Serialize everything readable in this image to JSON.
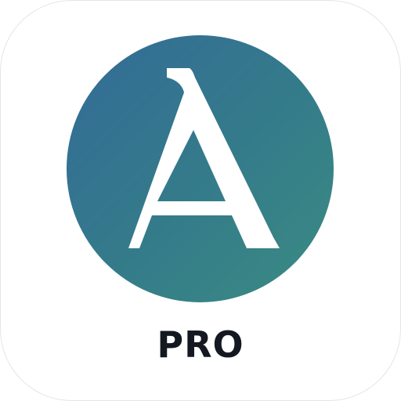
{
  "logo": {
    "letter": "A",
    "icon": "serif-letter-a-icon",
    "gradient_start": "#336b97",
    "gradient_end": "#3a8b82",
    "letter_color": "#ffffff"
  },
  "badge": {
    "label": "PRO",
    "color": "#141820"
  }
}
